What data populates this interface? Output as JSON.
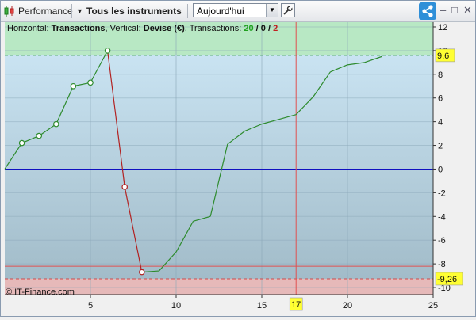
{
  "toolbar": {
    "performance_label": "Performance",
    "instruments_label": "Tous les instruments",
    "period_value": "Aujourd'hui",
    "window_buttons": {
      "minimize": "–",
      "maximize": "□",
      "close": "✕"
    }
  },
  "icons": {
    "performance": "candlestick-icon",
    "dropdown": "triangle-down-icon",
    "settings": "wrench-icon",
    "share": "share-icon"
  },
  "header": {
    "horizontal_prefix": "Horizontal: ",
    "horizontal_value": "Transactions",
    "vertical_prefix": ", Vertical: ",
    "vertical_value": "Devise (€)",
    "transactions_prefix": ", Transactions: ",
    "winners": "20",
    "slash1": " / ",
    "neutral": "0",
    "slash2": " / ",
    "losers": "2"
  },
  "watermark": "© IT-Finance.com",
  "colors": {
    "gain": "#2e8b2e",
    "loss": "#b22222",
    "zero_line": "#1010c0",
    "cursor": "#e05050",
    "badge": "#ffff33",
    "upper_band": "#b8e8c4",
    "lower_band": "#e6b9b9"
  },
  "chart_data": {
    "type": "line",
    "xlim": [
      0,
      25
    ],
    "ylim": [
      -10.6,
      12.4
    ],
    "x_ticks": [
      "5",
      "10",
      "15",
      "20",
      "25"
    ],
    "x_tick_values": [
      5,
      10,
      15,
      20,
      25
    ],
    "y_ticks": [
      "12",
      "10",
      "8",
      "6",
      "4",
      "2",
      "0",
      "-2",
      "-4",
      "-6",
      "-8",
      "-10"
    ],
    "y_tick_values": [
      12,
      10,
      8,
      6,
      4,
      2,
      0,
      -2,
      -4,
      -6,
      -8,
      -10
    ],
    "max_value_label": "9,6",
    "max_value": 9.6,
    "min_value_label": "-9,26",
    "min_value": -9.26,
    "cursor_x_label": "17",
    "cursor_x": 17,
    "series": [
      {
        "x": [
          0,
          1,
          2,
          3,
          4,
          5,
          6,
          7,
          8,
          9,
          10,
          11,
          12,
          13,
          14,
          15,
          16,
          17,
          18,
          19,
          20,
          21,
          22
        ],
        "y": [
          0,
          2.2,
          2.8,
          3.8,
          7.0,
          7.3,
          10.0,
          -1.5,
          -8.7,
          -8.6,
          -7.0,
          -4.4,
          -4.0,
          2.1,
          3.2,
          3.8,
          4.2,
          4.6,
          6.1,
          8.2,
          8.8,
          9.0,
          9.5
        ]
      }
    ],
    "open_markers_x": [
      1,
      2,
      3,
      4,
      5,
      6,
      7,
      8
    ]
  }
}
